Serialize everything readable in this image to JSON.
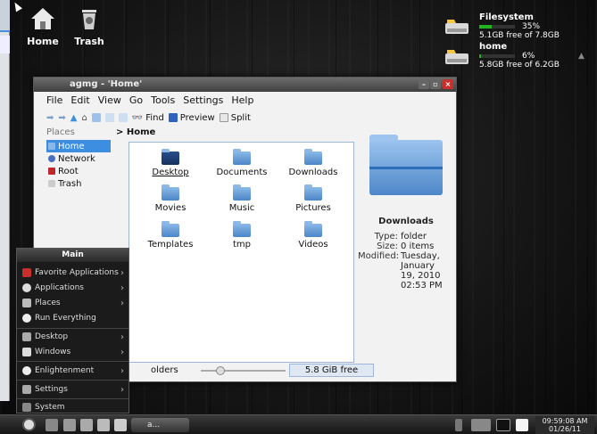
{
  "desktop": {
    "icons": [
      {
        "label": "Home",
        "icon": "home-icon"
      },
      {
        "label": "Trash",
        "icon": "trash-icon"
      }
    ],
    "disks": [
      {
        "name": "Filesystem",
        "percent": "35%",
        "free": "5.1GB free of 7.8GB",
        "fill": 0.35
      },
      {
        "name": "home",
        "percent": "6%",
        "free": "5.8GB free of 6.2GB",
        "fill": 0.06
      }
    ]
  },
  "window": {
    "title": "agmg - 'Home'",
    "menu": [
      "File",
      "Edit",
      "View",
      "Go",
      "Tools",
      "Settings",
      "Help"
    ],
    "toolbar": {
      "find": "Find",
      "preview": "Preview",
      "split": "Split"
    },
    "places_header": "Places",
    "places": [
      "Home",
      "Network",
      "Root",
      "Trash"
    ],
    "path": "> Home",
    "files": [
      "Desktop",
      "Documents",
      "Downloads",
      "Movies",
      "Music",
      "Pictures",
      "Templates",
      "tmp",
      "Videos"
    ],
    "info": {
      "name": "Downloads",
      "type_label": "Type:",
      "type": "folder",
      "size_label": "Size:",
      "size": "0 items",
      "modified_label": "Modified:",
      "modified": [
        "Tuesday,",
        "January",
        "19, 2010",
        "02:53 PM"
      ]
    },
    "status": {
      "left": "olders",
      "free": "5.8 GiB free"
    }
  },
  "start_menu": {
    "title": "Main",
    "items": [
      {
        "label": "Favorite Applications",
        "arrow": "›"
      },
      {
        "label": "Applications",
        "arrow": "›"
      },
      {
        "label": "Places",
        "arrow": "›"
      },
      {
        "label": "Run Everything",
        "arrow": ""
      },
      {
        "label": "Desktop",
        "arrow": "›"
      },
      {
        "label": "Windows",
        "arrow": "›"
      },
      {
        "label": "Enlightenment",
        "arrow": "›"
      },
      {
        "label": "Settings",
        "arrow": "›"
      },
      {
        "label": "System",
        "arrow": ""
      }
    ]
  },
  "taskbar": {
    "task_label": "a...",
    "time": "09:59:08 AM",
    "date": "01/26/11"
  },
  "colors": {
    "accent": "#3d8ee0",
    "bar": "#1fb41f",
    "close": "#c9302c"
  }
}
